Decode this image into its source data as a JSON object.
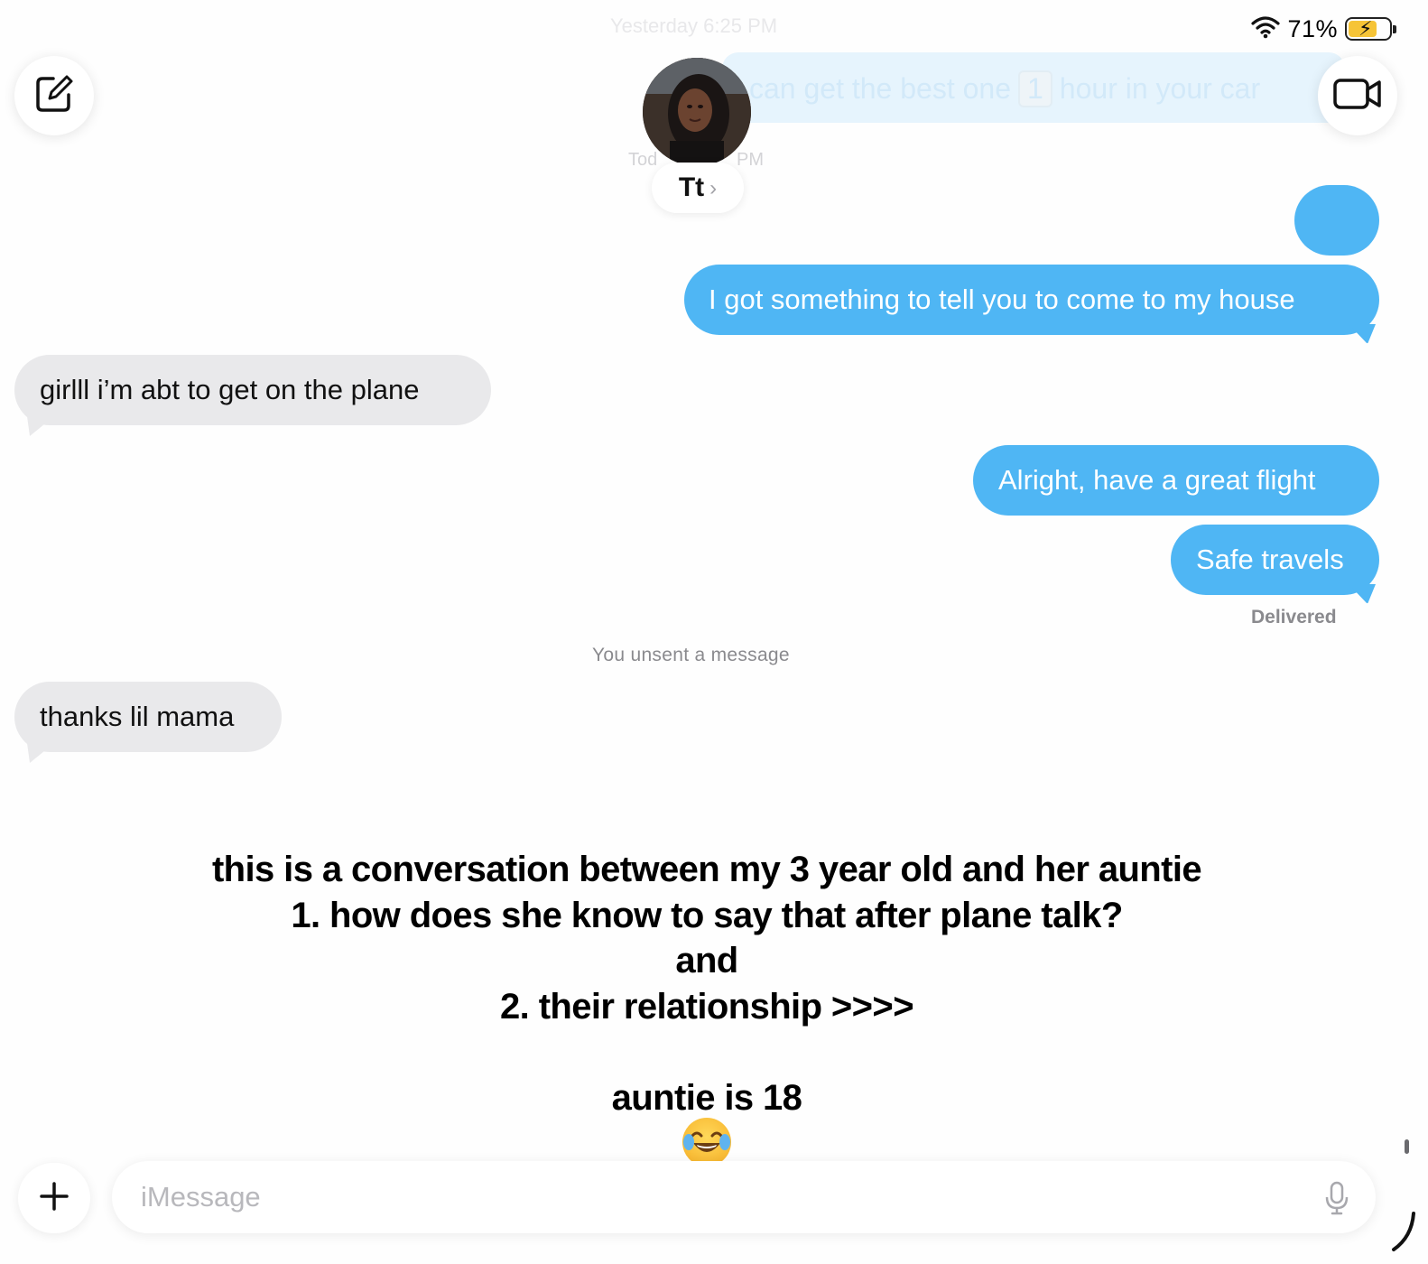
{
  "status": {
    "battery_percent": "71%",
    "battery_level": 0.71
  },
  "background_content": {
    "top_timestamp": "Yesterday 6:25 PM",
    "bubble_text_a": "can get the best one",
    "bubble_key": "1",
    "bubble_text_b": "hour in your car",
    "timestamp_left": "Tod",
    "timestamp_right": "PM"
  },
  "header": {
    "contact_name": "Tt",
    "chevron": "›"
  },
  "messages": [
    {
      "direction": "out",
      "text": "I got something to tell you to come to my house"
    },
    {
      "direction": "in",
      "text": "girlll i’m abt to get on the plane"
    },
    {
      "direction": "out",
      "text": "Alright, have a great flight"
    },
    {
      "direction": "out",
      "text": "Safe travels"
    },
    {
      "direction": "in",
      "text": "thanks lil mama"
    }
  ],
  "delivered_label": "Delivered",
  "unsent_notice": "You unsent a message",
  "caption": {
    "lines": [
      "this is a conversation between my 3 year old and her auntie",
      "1. how does she know to say that after plane talk?",
      "and",
      "2. their relationship >>>>",
      "",
      "auntie is 18"
    ]
  },
  "input": {
    "placeholder": "iMessage"
  },
  "icons": {
    "compose": "compose-icon",
    "facetime": "video-camera-icon",
    "plus": "plus-icon",
    "mic": "microphone-icon",
    "wifi": "wifi-icon",
    "battery": "battery-charging-icon",
    "emoji": "face-with-tears-of-joy-emoji"
  },
  "colors": {
    "outgoing": "#4fb6f4",
    "incoming": "#e9e9eb",
    "battery_charging": "#f6c437"
  }
}
